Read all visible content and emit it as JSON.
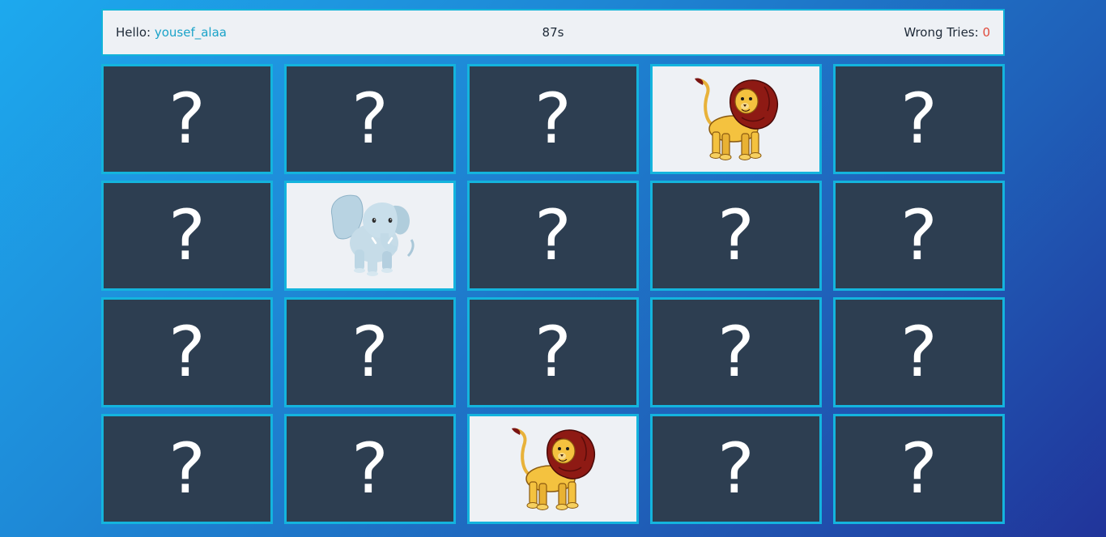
{
  "info": {
    "hello_label": "Hello:",
    "player_name": "yousef_alaa",
    "timer": "87s",
    "wrong_tries_label": "Wrong Tries:",
    "wrong_tries_value": "0"
  },
  "hidden_symbol": "?",
  "cards": [
    {
      "state": "hidden"
    },
    {
      "state": "hidden"
    },
    {
      "state": "hidden"
    },
    {
      "state": "open",
      "animal": "lion"
    },
    {
      "state": "hidden"
    },
    {
      "state": "hidden"
    },
    {
      "state": "open",
      "animal": "elephant"
    },
    {
      "state": "hidden"
    },
    {
      "state": "hidden"
    },
    {
      "state": "hidden"
    },
    {
      "state": "hidden"
    },
    {
      "state": "hidden"
    },
    {
      "state": "hidden"
    },
    {
      "state": "hidden"
    },
    {
      "state": "hidden"
    },
    {
      "state": "hidden"
    },
    {
      "state": "hidden"
    },
    {
      "state": "open",
      "animal": "lion"
    },
    {
      "state": "hidden"
    },
    {
      "state": "hidden"
    }
  ],
  "colors": {
    "card_back": "#2d3e51",
    "card_border": "#14b4dd",
    "card_open": "#eef1f5",
    "accent_name": "#1aa3c9",
    "accent_tries": "#e04b3c"
  }
}
